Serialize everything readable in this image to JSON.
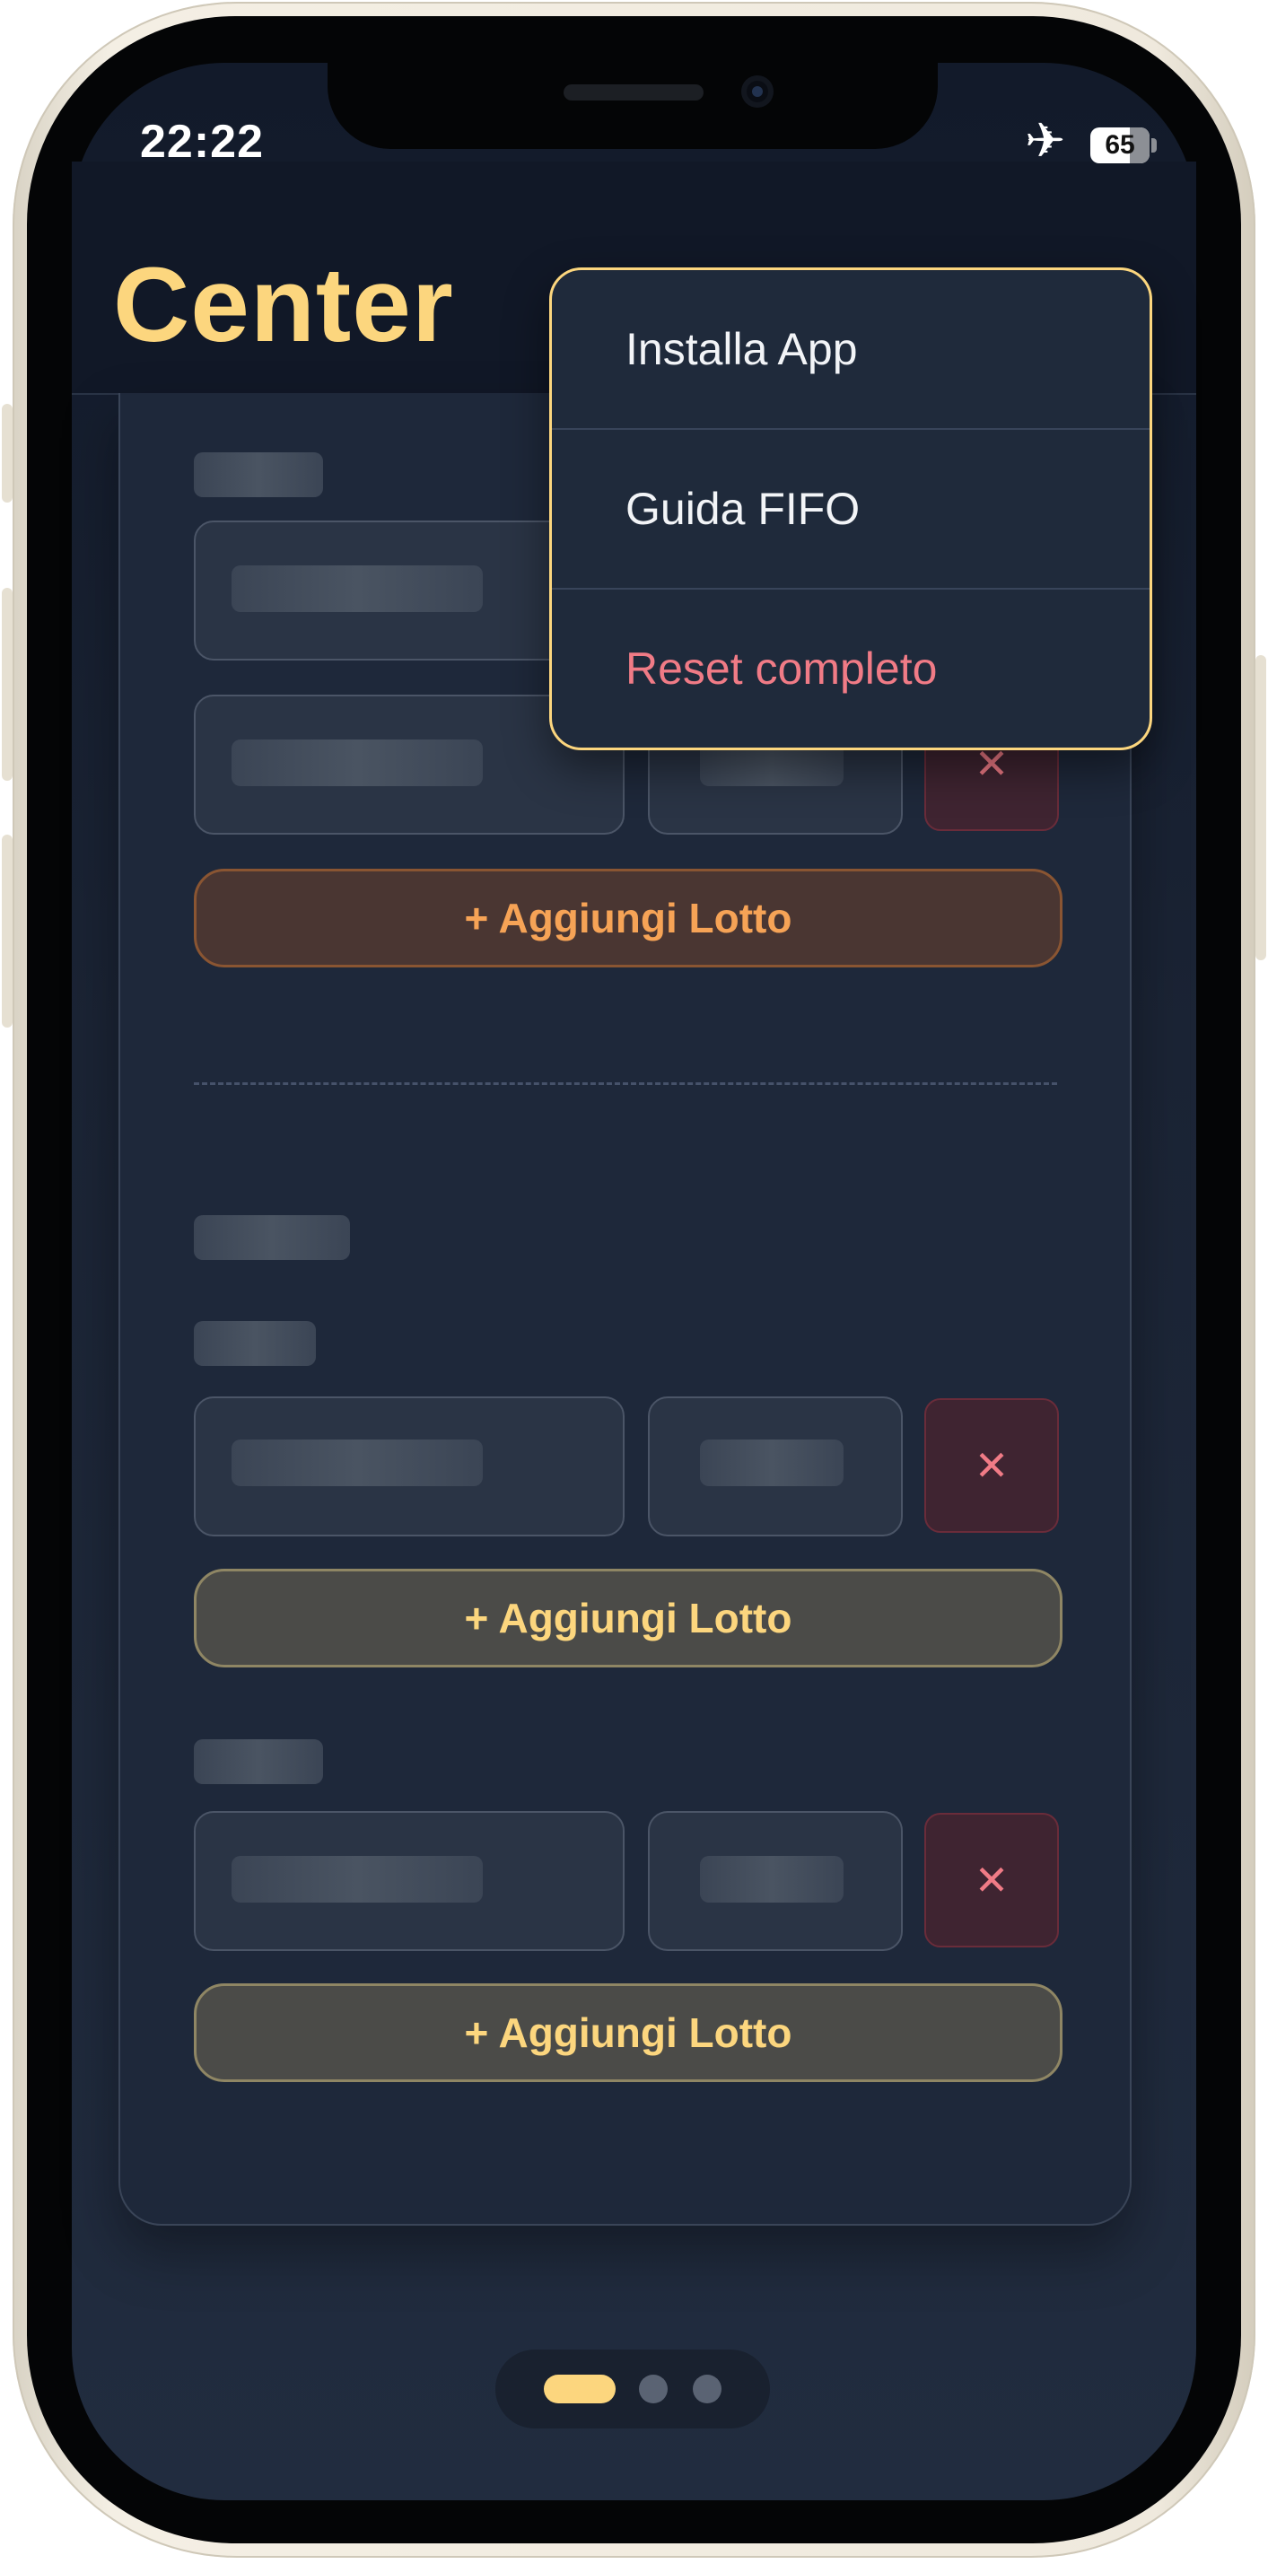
{
  "status_bar": {
    "time": "22:22",
    "airplane_icon": "airplane-icon",
    "battery_level": "65"
  },
  "header": {
    "title": "Center"
  },
  "menu": {
    "items": [
      {
        "label": "Installa App",
        "color": "#f2f4f7"
      },
      {
        "label": "Guida FIFO",
        "color": "#f2f4f7"
      },
      {
        "label": "Reset completo",
        "color": "#f07b86"
      }
    ]
  },
  "form": {
    "remove_glyph": "✕",
    "add_lot_label": "+ Aggiungi Lotto"
  },
  "pager": {
    "pages": 3,
    "active_index": 0
  },
  "colors": {
    "accent": "#fcd67e",
    "orange": "#f6a356",
    "danger": "#f07b86",
    "background": "#1e283a"
  }
}
